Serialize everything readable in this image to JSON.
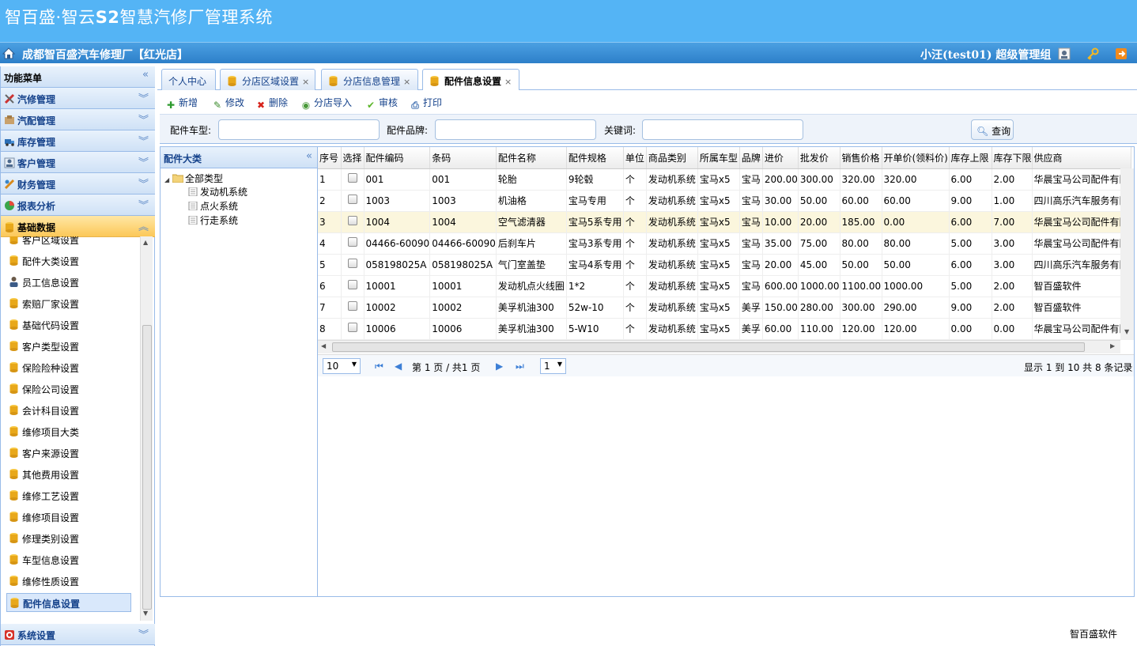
{
  "header": {
    "title_a": "智百盛·智云",
    "title_b": "S2",
    "title_c": "智慧汽修厂管理系统",
    "shop": "成都智百盛汽车修理厂【红光店】",
    "user": "小汪(test01) 超级管理组"
  },
  "sidebar": {
    "title": "功能菜单",
    "groups": [
      {
        "label": "汽修管理"
      },
      {
        "label": "汽配管理"
      },
      {
        "label": "库存管理"
      },
      {
        "label": "客户管理"
      },
      {
        "label": "财务管理"
      },
      {
        "label": "报表分析"
      },
      {
        "label": "基础数据"
      },
      {
        "label": "系统设置"
      }
    ],
    "items": [
      {
        "label": "客户区域设置"
      },
      {
        "label": "配件大类设置"
      },
      {
        "label": "员工信息设置"
      },
      {
        "label": "索赔厂家设置"
      },
      {
        "label": "基础代码设置"
      },
      {
        "label": "客户类型设置"
      },
      {
        "label": "保险险种设置"
      },
      {
        "label": "保险公司设置"
      },
      {
        "label": "会计科目设置"
      },
      {
        "label": "维修项目大类"
      },
      {
        "label": "客户来源设置"
      },
      {
        "label": "其他费用设置"
      },
      {
        "label": "维修工艺设置"
      },
      {
        "label": "维修项目设置"
      },
      {
        "label": "修理类别设置"
      },
      {
        "label": "车型信息设置"
      },
      {
        "label": "维修性质设置"
      },
      {
        "label": "配件信息设置"
      }
    ]
  },
  "tabs": [
    {
      "label": "个人中心"
    },
    {
      "label": "分店区域设置"
    },
    {
      "label": "分店信息管理"
    },
    {
      "label": "配件信息设置"
    }
  ],
  "toolbar": {
    "add": "新增",
    "edit": "修改",
    "delete": "删除",
    "import": "分店导入",
    "audit": "审核",
    "print": "打印"
  },
  "search": {
    "car_type_label": "配件车型:",
    "brand_label": "配件品牌:",
    "keyword_label": "关键词:",
    "button": "查询"
  },
  "tree": {
    "title": "配件大类",
    "root": "全部类型",
    "children": [
      {
        "label": "发动机系统"
      },
      {
        "label": "点火系统"
      },
      {
        "label": "行走系统"
      }
    ]
  },
  "grid": {
    "columns": [
      "序号",
      "选择",
      "配件编码",
      "条码",
      "配件名称",
      "配件规格",
      "单位",
      "商品类别",
      "所属车型",
      "品牌",
      "进价",
      "批发价",
      "销售价格",
      "开单价(领料价)",
      "库存上限",
      "库存下限",
      "供应商"
    ],
    "rows": [
      [
        "1",
        "",
        "001",
        "001",
        "轮胎",
        "9轮毂",
        "个",
        "发动机系统",
        "宝马x5",
        "宝马",
        "200.00",
        "300.00",
        "320.00",
        "320.00",
        "6.00",
        "2.00",
        "华晨宝马公司配件有限"
      ],
      [
        "2",
        "",
        "1003",
        "1003",
        "机油格",
        "宝马专用",
        "个",
        "发动机系统",
        "宝马x5",
        "宝马",
        "30.00",
        "50.00",
        "60.00",
        "60.00",
        "9.00",
        "1.00",
        "四川高乐汽车服务有限"
      ],
      [
        "3",
        "",
        "1004",
        "1004",
        "空气滤清器",
        "宝马5系专用",
        "个",
        "发动机系统",
        "宝马x5",
        "宝马",
        "10.00",
        "20.00",
        "185.00",
        "0.00",
        "6.00",
        "7.00",
        "华晨宝马公司配件有限"
      ],
      [
        "4",
        "",
        "04466-60090",
        "04466-60090",
        "后刹车片",
        "宝马3系专用",
        "个",
        "发动机系统",
        "宝马x5",
        "宝马",
        "35.00",
        "75.00",
        "80.00",
        "80.00",
        "5.00",
        "3.00",
        "华晨宝马公司配件有限"
      ],
      [
        "5",
        "",
        "058198025A",
        "058198025A",
        "气门室盖垫",
        "宝马4系专用",
        "个",
        "发动机系统",
        "宝马x5",
        "宝马",
        "20.00",
        "45.00",
        "50.00",
        "50.00",
        "6.00",
        "3.00",
        "四川高乐汽车服务有限"
      ],
      [
        "6",
        "",
        "10001",
        "10001",
        "发动机点火线圈",
        "1*2",
        "个",
        "发动机系统",
        "宝马x5",
        "宝马",
        "600.00",
        "1000.00",
        "1100.00",
        "1000.00",
        "5.00",
        "2.00",
        "智百盛软件"
      ],
      [
        "7",
        "",
        "10002",
        "10002",
        "美孚机油300",
        "52w-10",
        "个",
        "发动机系统",
        "宝马x5",
        "美孚",
        "150.00",
        "280.00",
        "300.00",
        "290.00",
        "9.00",
        "2.00",
        "智百盛软件"
      ],
      [
        "8",
        "",
        "10006",
        "10006",
        "美孚机油300",
        "5-W10",
        "个",
        "发动机系统",
        "宝马x5",
        "美孚",
        "60.00",
        "110.00",
        "120.00",
        "120.00",
        "0.00",
        "0.00",
        "华晨宝马公司配件有限"
      ]
    ]
  },
  "pager": {
    "page_size": "10",
    "page_info": "第 1 页 / 共1 页",
    "page_select": "1",
    "summary": "显示 1 到 10 共 8 条记录"
  },
  "footer": {
    "brand": "智百盛软件"
  },
  "colors": {
    "header": "#54b4f5",
    "accent": "#15428b",
    "active_group": "#fcc858"
  }
}
